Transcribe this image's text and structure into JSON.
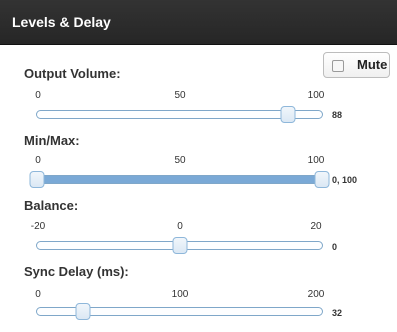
{
  "panel": {
    "title": "Levels & Delay",
    "mute": {
      "label": "Mute",
      "checked": false
    }
  },
  "sliders": [
    {
      "label": "Output Volume:",
      "ticks": [
        "0",
        "50",
        "100"
      ],
      "min": 0,
      "max": 100,
      "value": 88,
      "value_text": "88"
    },
    {
      "label": "Min/Max:",
      "ticks": [
        "0",
        "50",
        "100"
      ],
      "min": 0,
      "max": 100,
      "range": [
        0,
        100
      ],
      "value_text": "0, 100"
    },
    {
      "label": "Balance:",
      "ticks": [
        "-20",
        "0",
        "20"
      ],
      "min": -20,
      "max": 20,
      "value": 0,
      "value_text": "0"
    },
    {
      "label": "Sync Delay (ms):",
      "ticks": [
        "0",
        "100",
        "200"
      ],
      "min": 0,
      "max": 200,
      "value": 32,
      "value_text": "32"
    }
  ],
  "colors": {
    "header_bg": "#2b2b2b",
    "track_border": "#7fa7c9",
    "range_fill": "#7aa9d6"
  }
}
